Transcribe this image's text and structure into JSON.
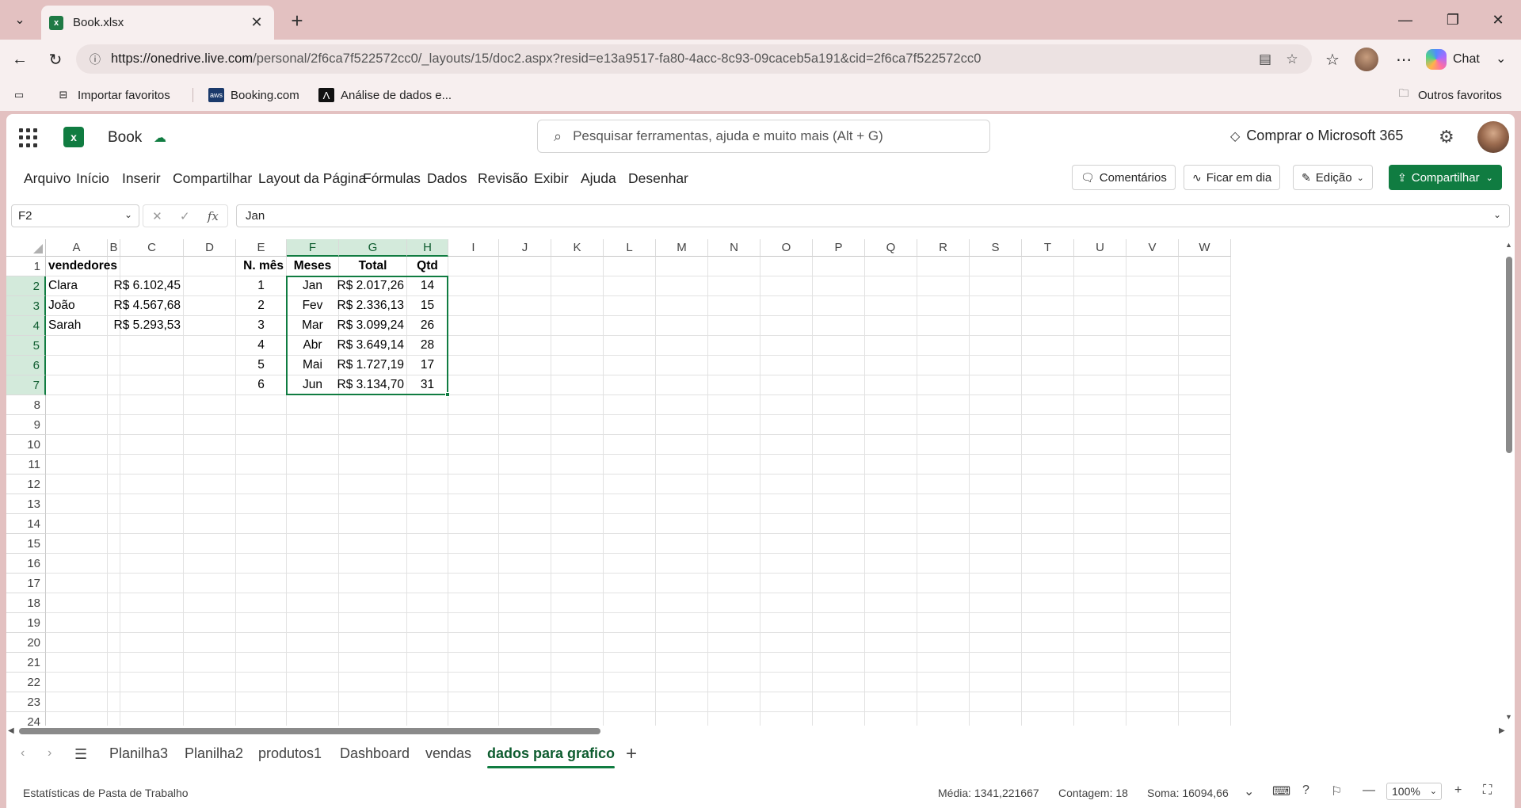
{
  "browser": {
    "tab_title": "Book.xlsx",
    "url_host": "https://onedrive.live.com",
    "url_path": "/personal/2f6ca7f522572cc0/_layouts/15/doc2.aspx?resid=e13a9517-fa80-4acc-8c93-09caceb5a191&cid=2f6ca7f522572cc0",
    "chat_label": "Chat",
    "bookmarks": [
      "Importar favoritos",
      "Booking.com",
      "Análise de dados e..."
    ],
    "other_favorites": "Outros favoritos"
  },
  "app": {
    "book_name": "Book",
    "search_placeholder": "Pesquisar ferramentas, ajuda e muito mais (Alt + G)",
    "buy_label": "Comprar o Microsoft 365",
    "menu": [
      "Arquivo",
      "Início",
      "Inserir",
      "Compartilhar",
      "Layout da Página",
      "Fórmulas",
      "Dados",
      "Revisão",
      "Exibir",
      "Ajuda",
      "Desenhar"
    ],
    "comments_label": "Comentários",
    "catchup_label": "Ficar em dia",
    "editing_label": "Edição",
    "share_label": "Compartilhar",
    "name_box": "F2",
    "formula_value": "Jan",
    "fx_label": "fx"
  },
  "grid": {
    "columns": [
      "A",
      "B",
      "C",
      "D",
      "E",
      "F",
      "G",
      "H",
      "I",
      "J",
      "K",
      "L",
      "M",
      "N",
      "O",
      "P",
      "Q",
      "R",
      "S",
      "T",
      "U",
      "V",
      "W"
    ],
    "selected_columns": [
      "F",
      "G",
      "H"
    ],
    "row_numbers": [
      "1",
      "2",
      "3",
      "4",
      "5",
      "6",
      "7",
      "8",
      "9",
      "10",
      "11",
      "12",
      "13",
      "14",
      "15",
      "16",
      "17",
      "18",
      "19",
      "20",
      "21",
      "22",
      "23",
      "24"
    ],
    "selected_rows": [
      "2",
      "3",
      "4",
      "5",
      "6",
      "7"
    ],
    "cells": {
      "A1": "vendedores",
      "A2": "Clara",
      "A3": "João",
      "A4": "Sarah",
      "C2": "R$ 6.102,45",
      "C3": "R$ 4.567,68",
      "C4": "R$ 5.293,53",
      "E1": "N. mês",
      "E2": "1",
      "E3": "2",
      "E4": "3",
      "E5": "4",
      "E6": "5",
      "E7": "6",
      "F1": "Meses",
      "F2": "Jan",
      "F3": "Fev",
      "F4": "Mar",
      "F5": "Abr",
      "F6": "Mai",
      "F7": "Jun",
      "G1": "Total",
      "G2": "R$ 2.017,26",
      "G3": "R$ 2.336,13",
      "G4": "R$ 3.099,24",
      "G5": "R$ 3.649,14",
      "G6": "R$ 1.727,19",
      "G7": "R$ 3.134,70",
      "H1": "Qtd",
      "H2": "14",
      "H3": "15",
      "H4": "26",
      "H5": "28",
      "H6": "17",
      "H7": "31"
    }
  },
  "sheets": {
    "tabs": [
      "Planilha3",
      "Planilha2",
      "produtos1",
      "Dashboard",
      "vendas",
      "dados para grafico"
    ],
    "active": "dados para grafico"
  },
  "status": {
    "workbook_stats": "Estatísticas de Pasta de Trabalho",
    "average": "Média: 1341,221667",
    "count": "Contagem: 18",
    "sum": "Soma: 16094,66",
    "zoom": "100%"
  },
  "colors": {
    "excel_green": "#107c41",
    "header_selected": "#d3eadb",
    "browser_frame": "#e3c1c1"
  }
}
